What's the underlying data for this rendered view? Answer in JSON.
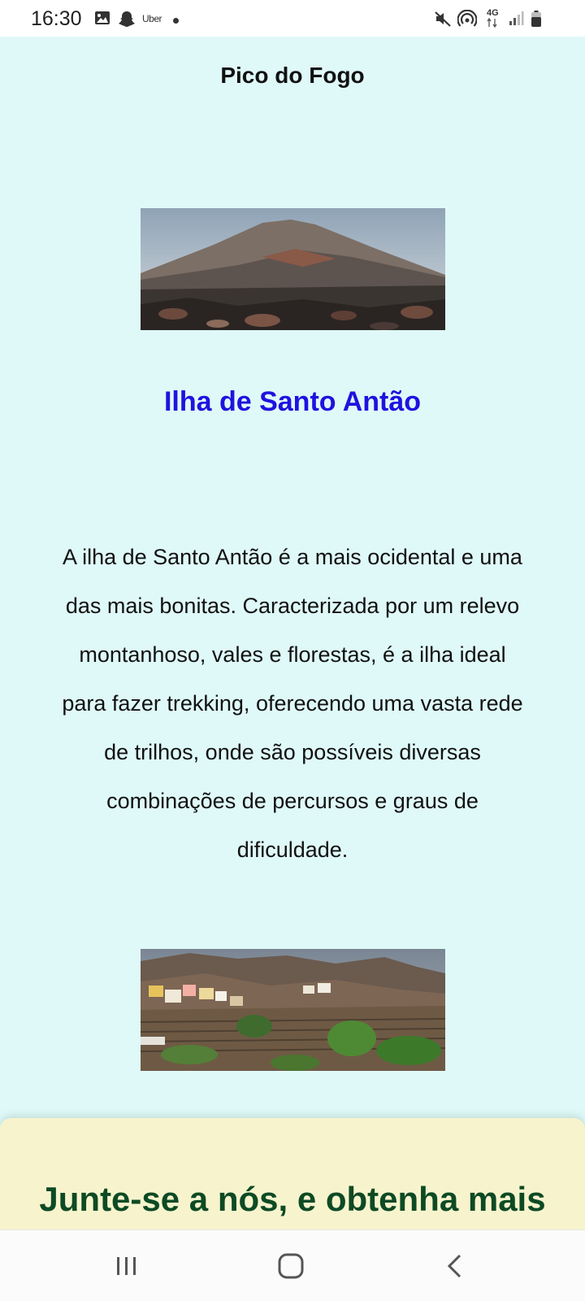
{
  "status_bar": {
    "time": "16:30",
    "left_icons": [
      "gallery-icon",
      "snapchat-icon",
      "uber-icon",
      "notification-dot-icon"
    ],
    "uber_label": "Uber",
    "network": "4G",
    "right_icons": [
      "mute-icon",
      "hotspot-icon",
      "network-4g-icon",
      "signal-icon",
      "battery-icon"
    ]
  },
  "page": {
    "title": "Pico do Fogo",
    "section": {
      "heading": "Ilha de Santo Antão",
      "description": "A ilha de Santo Antão é a mais ocidental e uma das mais bonitas. Caracterizada por um relevo montanhoso, vales e florestas, é a ilha ideal para fazer trekking, oferecendo uma vasta rede de trilhos, onde são possíveis diversas combinações de percursos e graus de dificuldade."
    },
    "join_panel": {
      "title": "Junte-se a nós, e obtenha mais"
    }
  },
  "nav_bar": {
    "buttons": [
      "recent-apps-icon",
      "home-icon",
      "back-icon"
    ]
  },
  "colors": {
    "page_background": "#dff9f8",
    "heading": "#1f12df",
    "join_panel_background": "#f7f4cd",
    "join_title": "#0d4a24"
  }
}
